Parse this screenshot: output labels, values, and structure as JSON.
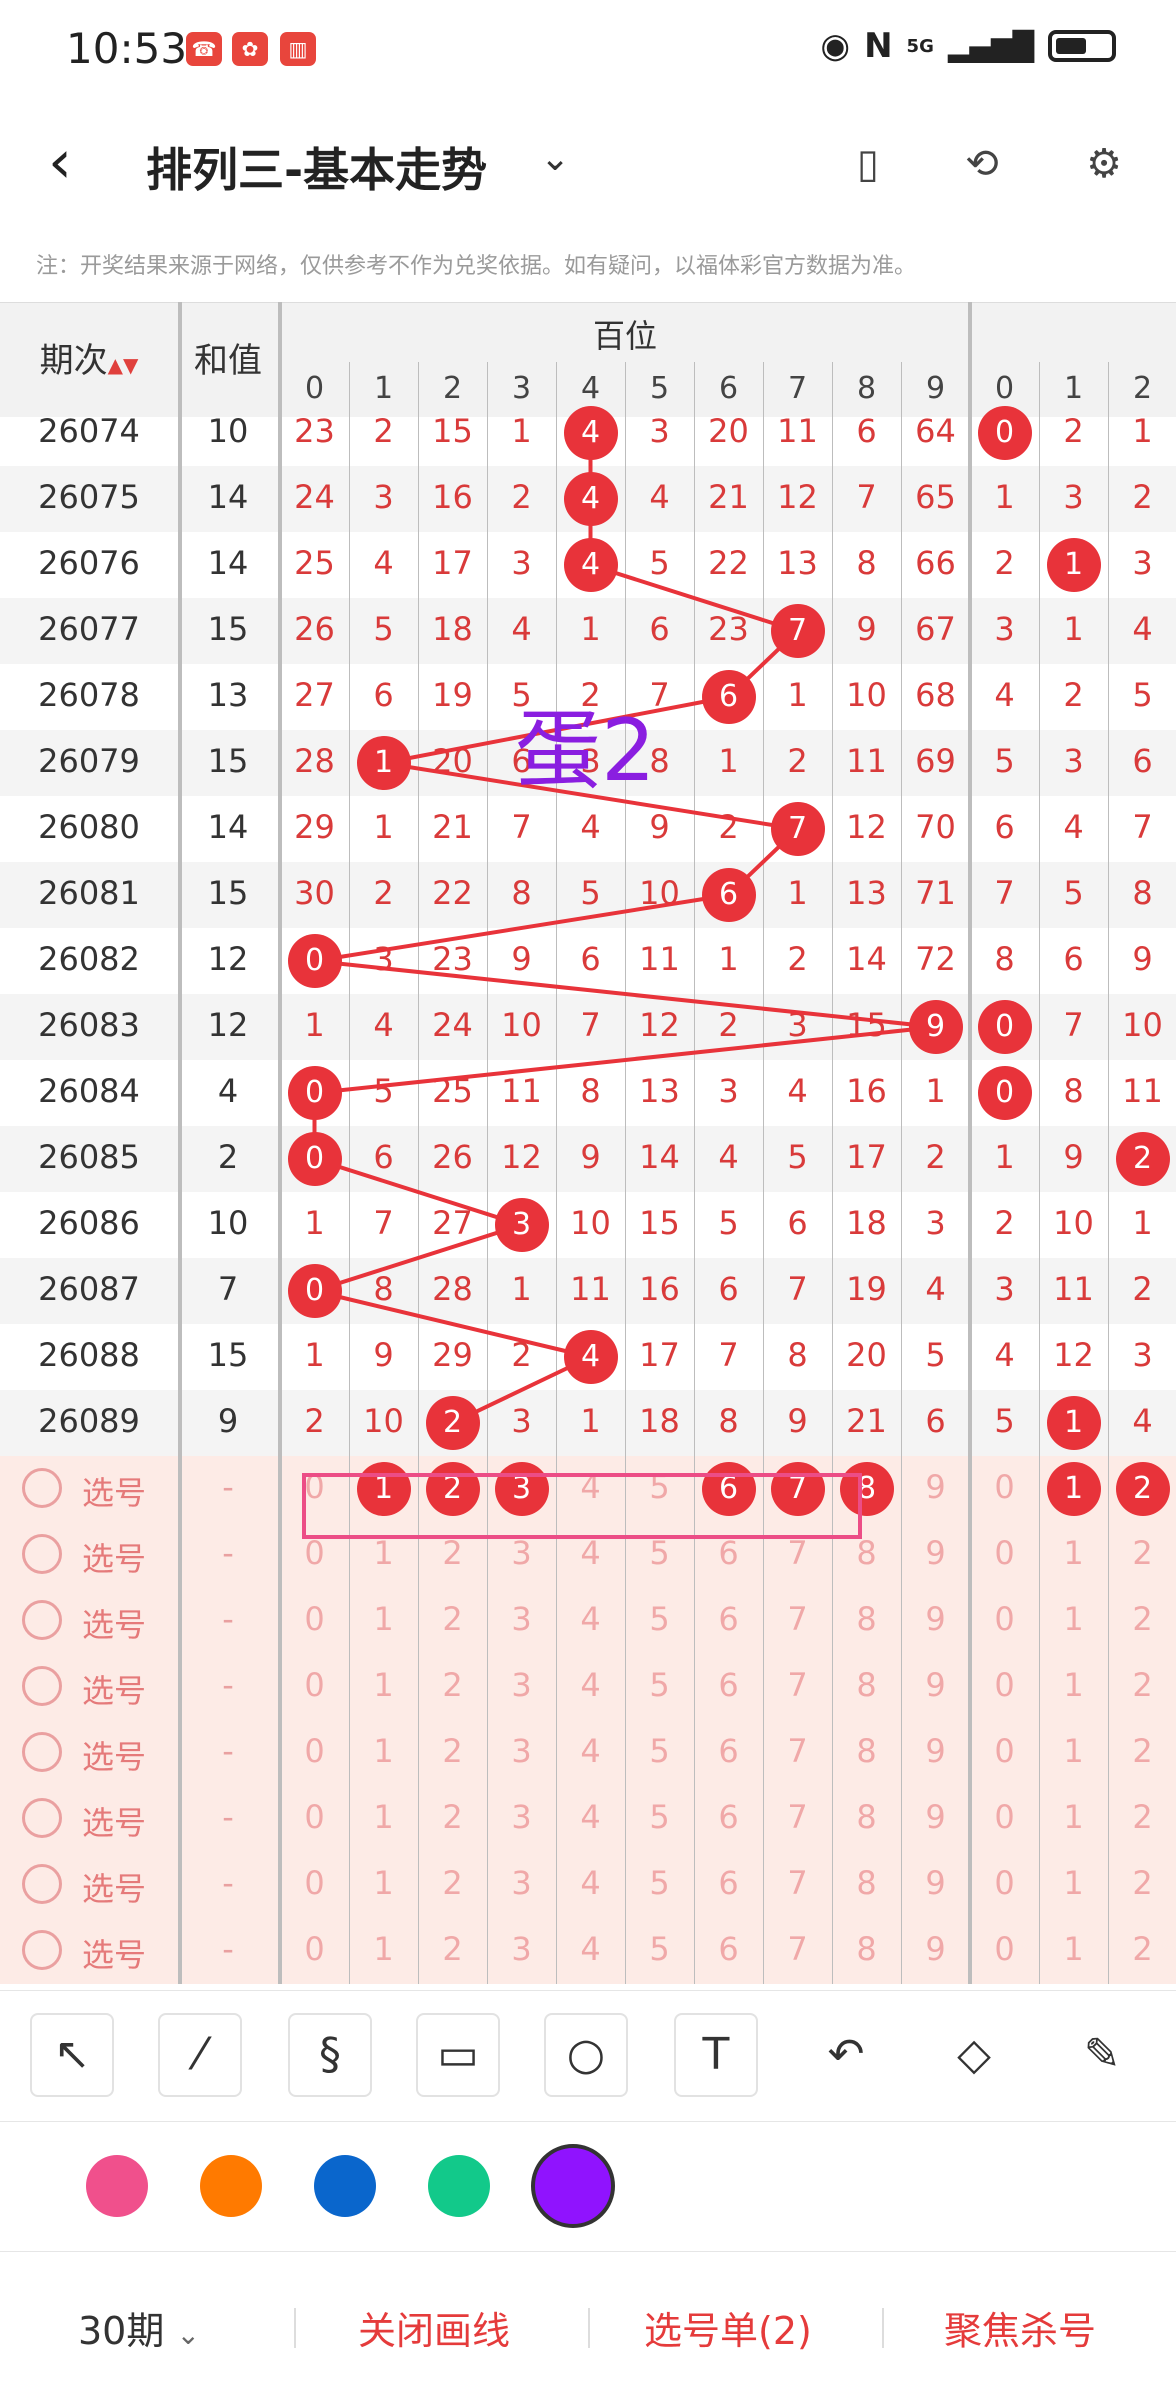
{
  "status": {
    "time": "10:53",
    "network": "5G"
  },
  "header": {
    "title": "排列三-基本走势"
  },
  "note": "注：开奖结果来源于网络，仅供参考不作为兑奖依据。如有疑问，以福体彩官方数据为准。",
  "table": {
    "col_period": "期次",
    "col_sum": "和值",
    "group_bai": "百位",
    "digits": [
      "0",
      "1",
      "2",
      "3",
      "4",
      "5",
      "6",
      "7",
      "8",
      "9",
      "0",
      "1",
      "2"
    ],
    "rows": [
      {
        "period": "26074",
        "sum": "10",
        "vals": [
          "23",
          "2",
          "15",
          "1",
          "4",
          "3",
          "20",
          "11",
          "6",
          "64",
          "0",
          "2",
          "1"
        ]
      },
      {
        "period": "26075",
        "sum": "14",
        "vals": [
          "24",
          "3",
          "16",
          "2",
          "4",
          "4",
          "21",
          "12",
          "7",
          "65",
          "1",
          "3",
          "2"
        ]
      },
      {
        "period": "26076",
        "sum": "14",
        "vals": [
          "25",
          "4",
          "17",
          "3",
          "4",
          "5",
          "22",
          "13",
          "8",
          "66",
          "2",
          "1",
          "3"
        ]
      },
      {
        "period": "26077",
        "sum": "15",
        "vals": [
          "26",
          "5",
          "18",
          "4",
          "1",
          "6",
          "23",
          "7",
          "9",
          "67",
          "3",
          "1",
          "4"
        ]
      },
      {
        "period": "26078",
        "sum": "13",
        "vals": [
          "27",
          "6",
          "19",
          "5",
          "2",
          "7",
          "6",
          "1",
          "10",
          "68",
          "4",
          "2",
          "5"
        ]
      },
      {
        "period": "26079",
        "sum": "15",
        "vals": [
          "28",
          "1",
          "20",
          "6",
          "3",
          "8",
          "1",
          "2",
          "11",
          "69",
          "5",
          "3",
          "6"
        ]
      },
      {
        "period": "26080",
        "sum": "14",
        "vals": [
          "29",
          "1",
          "21",
          "7",
          "4",
          "9",
          "2",
          "7",
          "12",
          "70",
          "6",
          "4",
          "7"
        ]
      },
      {
        "period": "26081",
        "sum": "15",
        "vals": [
          "30",
          "2",
          "22",
          "8",
          "5",
          "10",
          "6",
          "1",
          "13",
          "71",
          "7",
          "5",
          "8"
        ]
      },
      {
        "period": "26082",
        "sum": "12",
        "vals": [
          "0",
          "3",
          "23",
          "9",
          "6",
          "11",
          "1",
          "2",
          "14",
          "72",
          "8",
          "6",
          "9"
        ]
      },
      {
        "period": "26083",
        "sum": "12",
        "vals": [
          "1",
          "4",
          "24",
          "10",
          "7",
          "12",
          "2",
          "3",
          "15",
          "9",
          "0",
          "7",
          "10"
        ]
      },
      {
        "period": "26084",
        "sum": "4",
        "vals": [
          "0",
          "5",
          "25",
          "11",
          "8",
          "13",
          "3",
          "4",
          "16",
          "1",
          "0",
          "8",
          "11"
        ]
      },
      {
        "period": "26085",
        "sum": "2",
        "vals": [
          "0",
          "6",
          "26",
          "12",
          "9",
          "14",
          "4",
          "5",
          "17",
          "2",
          "1",
          "9",
          "2"
        ]
      },
      {
        "period": "26086",
        "sum": "10",
        "vals": [
          "1",
          "7",
          "27",
          "3",
          "10",
          "15",
          "5",
          "6",
          "18",
          "3",
          "2",
          "10",
          "1"
        ]
      },
      {
        "period": "26087",
        "sum": "7",
        "vals": [
          "0",
          "8",
          "28",
          "1",
          "11",
          "16",
          "6",
          "7",
          "19",
          "4",
          "3",
          "11",
          "2"
        ]
      },
      {
        "period": "26088",
        "sum": "15",
        "vals": [
          "1",
          "9",
          "29",
          "2",
          "4",
          "17",
          "7",
          "8",
          "20",
          "5",
          "4",
          "12",
          "3"
        ]
      },
      {
        "period": "26089",
        "sum": "9",
        "vals": [
          "2",
          "10",
          "2",
          "3",
          "1",
          "18",
          "8",
          "9",
          "21",
          "6",
          "5",
          "1",
          "4"
        ]
      }
    ],
    "pick_label": "选号",
    "pick_sum": "-",
    "pick_rows": 8,
    "hit_col_bai": [
      4,
      4,
      4,
      7,
      6,
      1,
      7,
      6,
      0,
      9,
      0,
      0,
      3,
      0,
      4,
      2
    ],
    "hit_col_shi": [
      0,
      null,
      1,
      null,
      null,
      null,
      null,
      null,
      null,
      0,
      0,
      2,
      null,
      null,
      null,
      1
    ],
    "selected_bai": [
      1,
      2,
      3,
      6,
      7,
      8
    ],
    "selected_shi": [
      1,
      2
    ]
  },
  "annotation_text": "蛋2",
  "tools": [
    "arrow-tool",
    "line-tool",
    "curve-tool",
    "rectangle-tool",
    "circle-tool",
    "text-tool",
    "undo-tool",
    "eraser-tool",
    "clear-tool"
  ],
  "colors": [
    "#f0508c",
    "#ff7a00",
    "#0a66cc",
    "#12c98a",
    "#9013fe"
  ],
  "selected_color": "#9013fe",
  "bottom": {
    "periods": "30期",
    "close_draw": "关闭画线",
    "pick_list": "选号单(2)",
    "focus_kill": "聚焦杀号"
  }
}
